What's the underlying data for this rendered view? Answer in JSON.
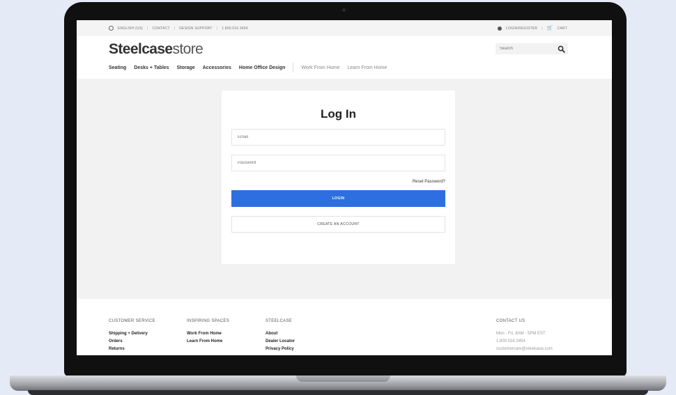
{
  "utility_bar": {
    "language": "ENGLISH (US)",
    "contact": "CONTACT",
    "design_support": "DESIGN SUPPORT",
    "phone": "1.800.016.3454",
    "login_register": "LOGIN/REGISTER",
    "cart": "CART",
    "separator": "|"
  },
  "header": {
    "brand_bold": "Steelcase",
    "brand_light": "store",
    "search_placeholder": "Search"
  },
  "nav": {
    "main_items": [
      "Seating",
      "Desks + Tables",
      "Storage",
      "Accessories",
      "Home Office Design"
    ],
    "secondary_items": [
      "Work From Home",
      "Learn From Home"
    ]
  },
  "login_form": {
    "title": "Log In",
    "email_placeholder": "Email",
    "password_placeholder": "Password",
    "reset_password": "Reset Password?",
    "login_button": "LOGIN",
    "create_account_button": "CREATE AN ACCOUNT"
  },
  "footer": {
    "customer_service": {
      "heading": "CUSTOMER SERVICE",
      "links": [
        "Shipping + Delivery",
        "Orders",
        "Returns"
      ]
    },
    "inspiring_spaces": {
      "heading": "INSPIRING SPACES",
      "links": [
        "Work From Home",
        "Learn From Home"
      ]
    },
    "steelcase": {
      "heading": "STEELCASE",
      "links": [
        "About",
        "Dealer Locator",
        "Privacy Policy"
      ]
    },
    "contact_us": {
      "heading": "CONTACT US",
      "lines": [
        "Mon - Fri, 8AM - 5PM EST",
        "1.800.016.3454",
        "customercare@steelcase.com"
      ]
    }
  },
  "colors": {
    "accent": "#2d6fe0",
    "page_background": "#f2f2f2",
    "backdrop": "#e4ebf6"
  }
}
